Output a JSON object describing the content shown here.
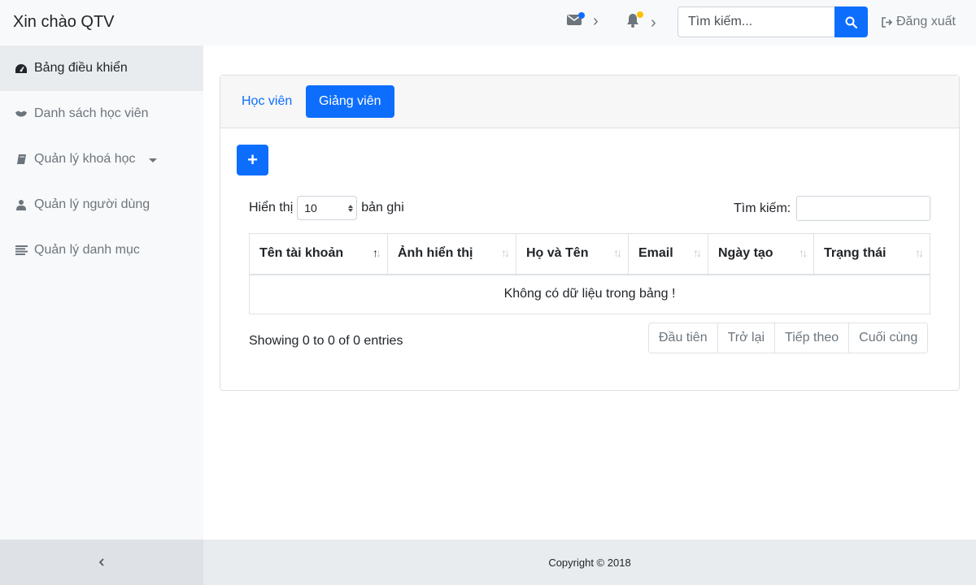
{
  "header": {
    "greeting": "Xin chào QTV",
    "search_placeholder": "Tìm kiếm...",
    "logout_label": "Đăng xuất",
    "mail_dot_color": "#0d6efd",
    "bell_dot_color": "#ffc107"
  },
  "sidebar": {
    "items": [
      {
        "label": "Bảng điều khiển",
        "icon": "dashboard-icon",
        "active": true
      },
      {
        "label": "Danh sách học viên",
        "icon": "handshake-icon"
      },
      {
        "label": "Quản lý khoá học",
        "icon": "book-icon",
        "has_dropdown": true
      },
      {
        "label": "Quản lý người dùng",
        "icon": "user-icon"
      },
      {
        "label": "Quản lý danh mục",
        "icon": "list-icon"
      }
    ],
    "collapse_icon": "chevron-left-icon"
  },
  "tabs": [
    {
      "label": "Học viên",
      "active": false
    },
    {
      "label": "Giảng viên",
      "active": true
    }
  ],
  "add_button_label": "+",
  "table_controls": {
    "show_prefix": "Hiển thị",
    "page_length": "10",
    "show_suffix": "bản ghi",
    "search_label": "Tìm kiếm:"
  },
  "table": {
    "columns": [
      "Tên tài khoản",
      "Ảnh hiển thị",
      "Họ và Tên",
      "Email",
      "Ngày tạo",
      "Trạng thái"
    ],
    "empty_message": "Không có dữ liệu trong bảng !"
  },
  "info_text": "Showing 0 to 0 of 0 entries",
  "pagination": {
    "first": "Đầu tiên",
    "previous": "Trở lại",
    "next": "Tiếp theo",
    "last": "Cuối cùng"
  },
  "footer": {
    "copyright": "Copyright © 2018"
  },
  "colors": {
    "primary": "#0d6efd",
    "sidebar_bg": "#f8f9fa",
    "active_bg": "#e9ecef"
  }
}
